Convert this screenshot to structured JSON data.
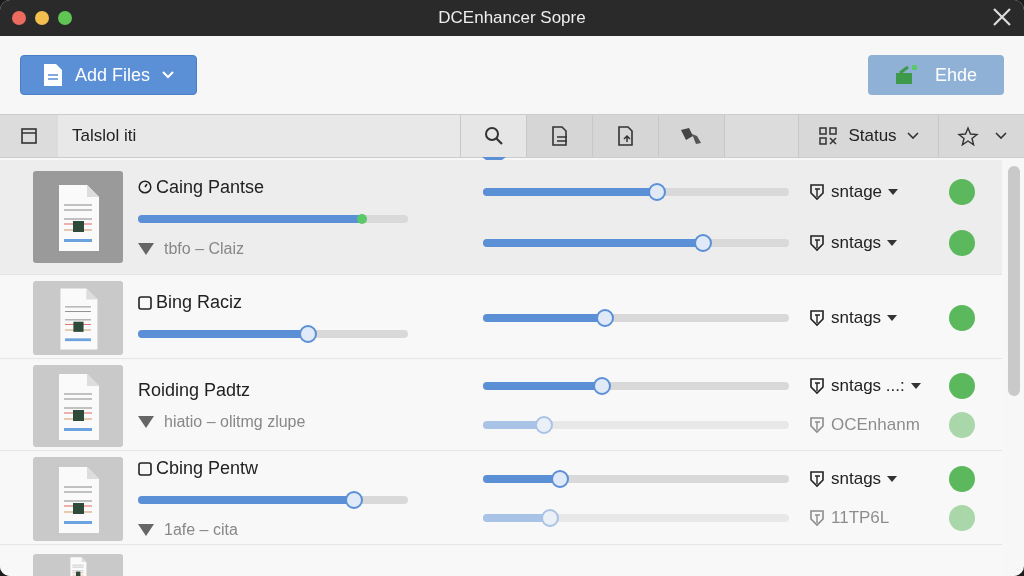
{
  "window": {
    "title": "DCEnhancer Sopre"
  },
  "toolbar": {
    "add_button": "Add Files",
    "action_button": "Ehde"
  },
  "header": {
    "select_all": {
      "checked": false
    },
    "name_column": "Talslol iti",
    "tools": [
      {
        "kind": "search",
        "selected": true
      },
      {
        "kind": "doc-list",
        "selected": false
      },
      {
        "kind": "doc-up",
        "selected": false
      },
      {
        "kind": "tags",
        "selected": false
      }
    ],
    "status_column": "Status"
  },
  "rows": [
    {
      "name": "Caing Pantse",
      "kind": "clock",
      "selected": true,
      "progress": {
        "level": 0.83,
        "done": true
      },
      "subtitle": "tbfo – Claiz",
      "lines": [
        {
          "level": 0.57,
          "status": "sntage",
          "dimmed": false
        },
        {
          "level": 0.72,
          "status": "sntags",
          "dimmed": false
        }
      ]
    },
    {
      "name": "Bing Raciz",
      "kind": "checkbox",
      "selected": false,
      "progress": {
        "level": 0.63,
        "done": false
      },
      "lines": [
        {
          "level": 0.4,
          "status": "sntags",
          "dimmed": false
        }
      ]
    },
    {
      "name": "Roiding Padtz",
      "kind": "plain",
      "selected": false,
      "subtitle": "hiatio – olitmg zlupe",
      "lines": [
        {
          "level": 0.39,
          "status": "sntags ...:",
          "dimmed": false
        },
        {
          "level": 0.2,
          "status": "OCEnhanm",
          "dimmed": true
        }
      ]
    },
    {
      "name": "Cbing Pentw",
      "kind": "checkbox",
      "selected": false,
      "progress": {
        "level": 0.8,
        "done": false
      },
      "subtitle": "1afe – cita",
      "lines": [
        {
          "level": 0.25,
          "status": "sntags",
          "dimmed": false
        },
        {
          "level": 0.22,
          "status": "11TP6L",
          "dimmed": true
        }
      ]
    },
    {
      "selected": false
    }
  ]
}
